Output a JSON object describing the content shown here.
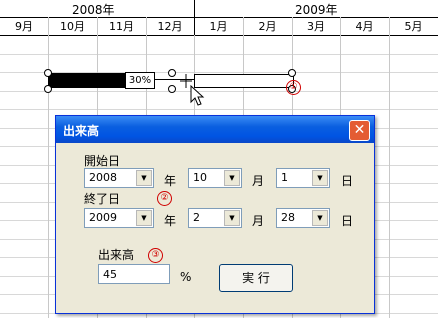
{
  "sheet": {
    "years": [
      "2008年",
      "2009年"
    ],
    "months": [
      "9月",
      "10月",
      "11月",
      "12月",
      "1月",
      "2月",
      "3月",
      "4月",
      "5月"
    ]
  },
  "gantt": {
    "percent_label": "30%"
  },
  "callouts": {
    "c1": "①",
    "c2": "②",
    "c3": "③"
  },
  "dialog": {
    "title": "出来高",
    "close_glyph": "✕",
    "start_label": "開始日",
    "end_label": "終了日",
    "start": {
      "year": "2008",
      "month": "10",
      "day": "1"
    },
    "end": {
      "year": "2009",
      "month": "2",
      "day": "28"
    },
    "unit_year": "年",
    "unit_month": "月",
    "unit_day": "日",
    "progress_label": "出来高",
    "progress_value": "45",
    "percent_sign": "%",
    "run_button": "実 行"
  }
}
